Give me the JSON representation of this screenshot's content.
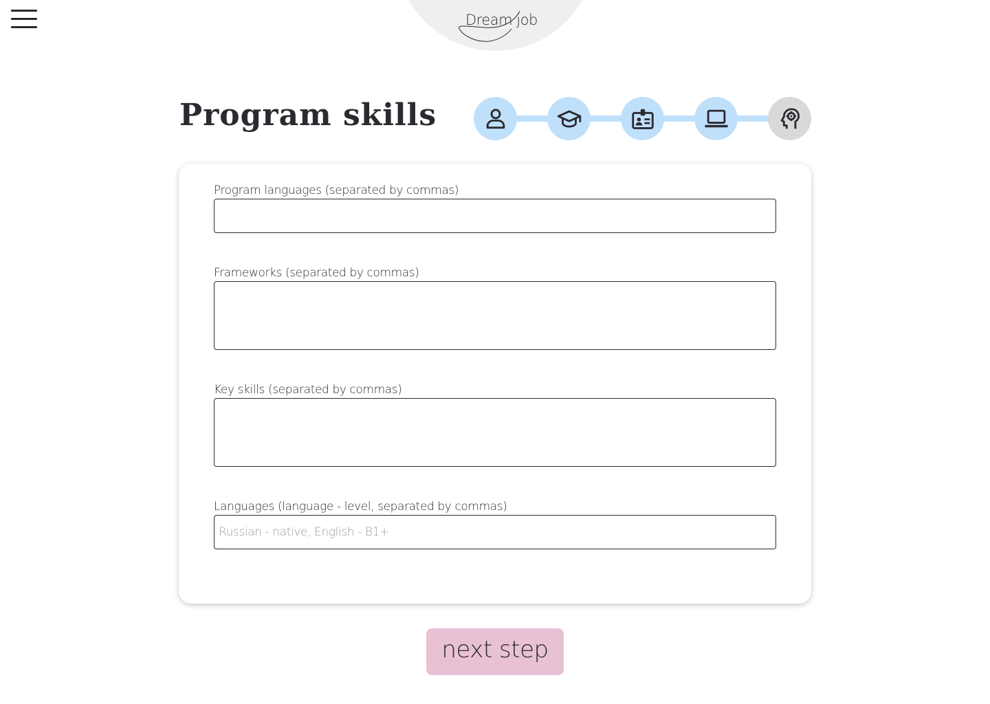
{
  "header": {
    "menu_icon": "hamburger-menu-icon",
    "logo_text": "Dream job"
  },
  "page": {
    "title": "Program skills"
  },
  "stepper": {
    "steps": [
      {
        "icon": "person-icon",
        "state": "completed"
      },
      {
        "icon": "graduation-cap-icon",
        "state": "completed"
      },
      {
        "icon": "id-badge-icon",
        "state": "completed"
      },
      {
        "icon": "laptop-icon",
        "state": "current"
      },
      {
        "icon": "head-gear-icon",
        "state": "upcoming"
      }
    ],
    "active_color": "#bfe0fb",
    "inactive_color": "#d9d9d9"
  },
  "form": {
    "fields": [
      {
        "label": "Program languages (separated by commas)",
        "value": "",
        "placeholder": ""
      },
      {
        "label": "Frameworks (separated by commas)",
        "value": "",
        "placeholder": ""
      },
      {
        "label": "Key skills (separated by commas)",
        "value": "",
        "placeholder": ""
      },
      {
        "label": "Languages (language - level, separated by commas)",
        "value": "",
        "placeholder": "Russian - native, English - B1+"
      }
    ]
  },
  "actions": {
    "next_label": "next step",
    "next_color": "#e9c1d4"
  }
}
